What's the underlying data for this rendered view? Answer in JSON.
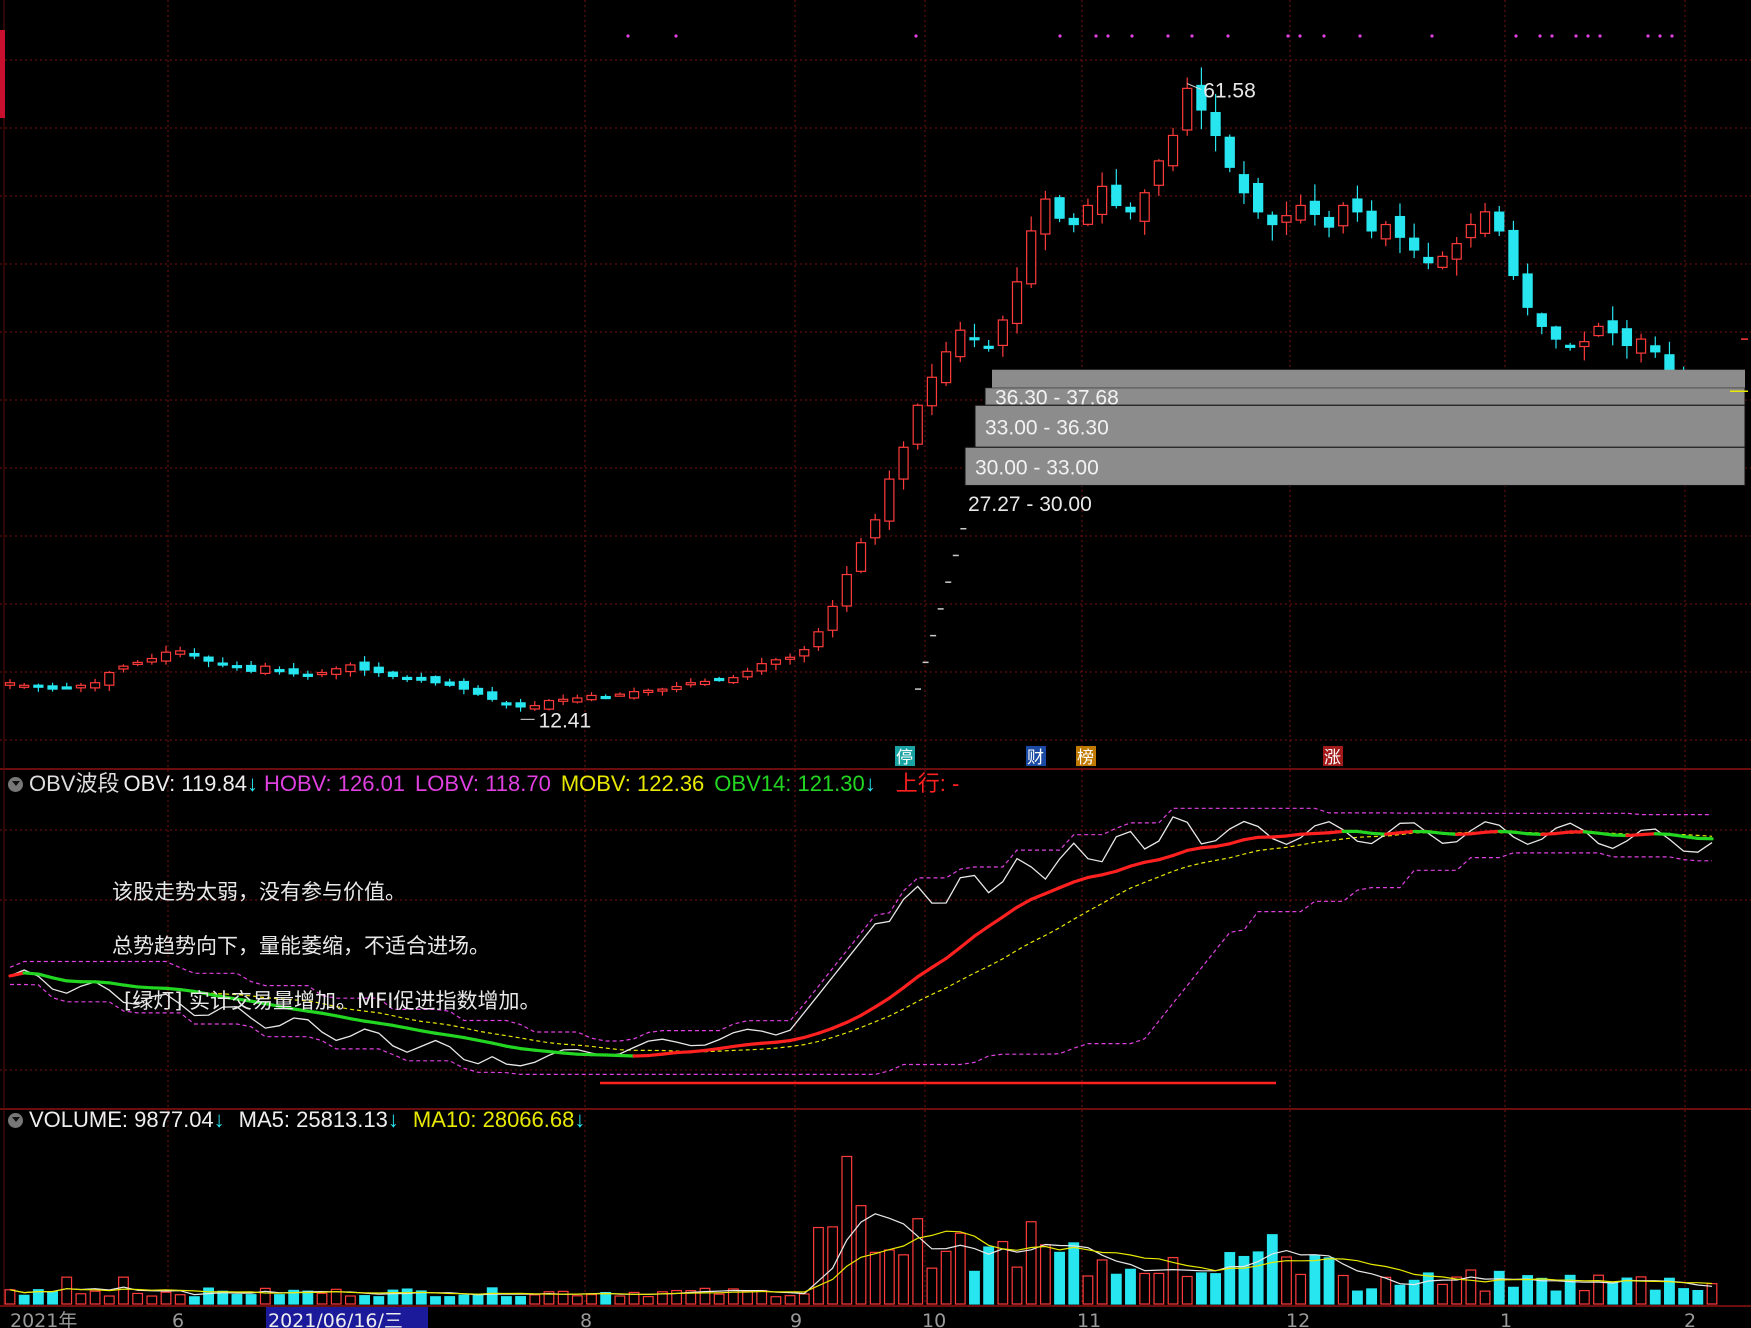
{
  "colors": {
    "up": "#ff3b3b",
    "down": "#27e6f0",
    "obv": "#e8e8e8",
    "hobv": "#e040e0",
    "lobv": "#e040e0",
    "mobv": "#e8e800",
    "obv14_down": "#22d622",
    "obv14_up": "#ff2020",
    "ma5": "#e8e8e8",
    "ma10": "#e8e800",
    "grid": "#7a1010",
    "chip": "#8c8c8c"
  },
  "price_panel": {
    "high_label": "61.58",
    "low_label": "12.41",
    "chip_zones": [
      "36.30 - 37.68",
      "33.00 - 36.30",
      "30.00 - 33.00",
      "27.27 - 30.00"
    ],
    "markers": [
      "停",
      "财",
      "榜",
      "涨"
    ]
  },
  "obv_panel": {
    "name": "OBV波段",
    "obv": "OBV: 119.84",
    "hobv": "HOBV: 126.01",
    "lobv": "LOBV: 118.70",
    "mobv": "MOBV: 122.36",
    "obv14": "OBV14: 121.30",
    "trend": "上行: -",
    "arrow": "↓",
    "notes": [
      "该股走势太弱，没有参与价值。",
      "总势趋势向下，量能萎缩，不适合进场。",
      "[绿灯] 实计交易量增加。MFI促进指数增加。"
    ]
  },
  "volume_panel": {
    "volume": "VOLUME: 9877.04",
    "ma5": "MA5: 25813.13",
    "ma10": "MA10: 28066.68",
    "arrow": "↓"
  },
  "time_axis": {
    "labels": [
      "2021年",
      "6",
      "2021/06/16/三",
      "8",
      "9",
      "10",
      "11",
      "12",
      "1",
      "2"
    ]
  },
  "chart_data": [
    {
      "type": "candlestick",
      "title": "",
      "x": "trading days (2021 May – 2022 Feb)",
      "y_range_estimate": [
        10,
        65
      ],
      "key_values": {
        "high": 61.58,
        "low": 12.41
      },
      "close_trajectory_estimate": [
        14.5,
        14.3,
        14.2,
        14.0,
        14.1,
        14.3,
        14.5,
        15.3,
        15.8,
        16.1,
        16.4,
        16.9,
        17.0,
        16.6,
        16.2,
        16.0,
        15.7,
        15.4,
        15.8,
        15.5,
        15.2,
        15.0,
        15.3,
        15.6,
        15.9,
        15.5,
        15.3,
        15.0,
        14.8,
        14.7,
        14.5,
        14.3,
        14.0,
        13.6,
        13.2,
        12.8,
        12.6,
        12.7,
        13.1,
        13.2,
        13.3,
        13.5,
        13.4,
        13.6,
        13.8,
        13.9,
        14.0,
        14.2,
        14.5,
        14.6,
        14.7,
        14.9,
        15.4,
        16.0,
        16.3,
        16.5,
        17.1,
        18.5,
        20.5,
        23.0,
        25.5,
        27.3,
        30.5,
        33.0,
        36.3,
        38.5,
        40.5,
        42.2,
        41.5,
        40.8,
        43.0,
        46.0,
        50.0,
        52.5,
        51.0,
        50.5,
        52.0,
        53.5,
        52.0,
        51.5,
        53.0,
        55.5,
        57.5,
        61.2,
        59.5,
        57.5,
        55.0,
        53.0,
        51.5,
        50.5,
        51.2,
        52.0,
        51.3,
        50.3,
        52.0,
        51.5,
        50.0,
        50.5,
        49.5,
        48.5,
        47.5,
        48.0,
        49.0,
        50.5,
        51.5,
        50.0,
        46.5,
        44.0,
        42.5,
        41.5,
        41.0,
        41.3,
        42.5,
        42.0,
        41.0,
        41.5,
        40.5,
        39.0,
        37.5,
        36.8,
        37.4
      ],
      "chip_zones": [
        "36.30 - 37.68",
        "33.00 - 36.30",
        "30.00 - 33.00",
        "27.27 - 30.00"
      ]
    },
    {
      "type": "line",
      "title": "OBV波段",
      "series": [
        {
          "name": "OBV",
          "last": 119.84
        },
        {
          "name": "HOBV",
          "last": 126.01
        },
        {
          "name": "LOBV",
          "last": 118.7
        },
        {
          "name": "MOBV",
          "last": 122.36
        },
        {
          "name": "OBV14",
          "last": 121.3
        }
      ]
    },
    {
      "type": "bar",
      "title": "VOLUME",
      "series": [
        {
          "name": "VOLUME",
          "last": 9877.04
        },
        {
          "name": "MA5",
          "last": 25813.13
        },
        {
          "name": "MA10",
          "last": 28066.68
        }
      ]
    }
  ]
}
